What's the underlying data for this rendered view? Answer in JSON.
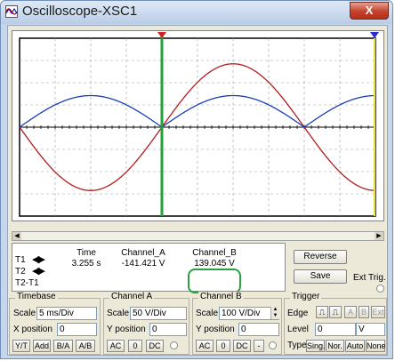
{
  "window": {
    "title": "Oscilloscope-XSC1",
    "close_label": "X",
    "accent": "#c3422c"
  },
  "readout": {
    "row_labels": [
      "T1",
      "T2",
      "T2-T1"
    ],
    "headers": {
      "time": "Time",
      "channel_a": "Channel_A",
      "channel_b": "Channel_B"
    },
    "t1": {
      "time": "3.255 s",
      "channel_a": "-141.421 V",
      "channel_b": "139.045 V"
    },
    "highlight_color": "#2aa043"
  },
  "buttons": {
    "reverse": "Reverse",
    "save": "Save",
    "ext_trig": "Ext Trig."
  },
  "timebase": {
    "title": "Timebase",
    "scale_label": "Scale",
    "scale_value": "5 ms/Div",
    "xpos_label": "X position",
    "xpos_value": "0",
    "modes": [
      "Y/T",
      "Add",
      "B/A",
      "A/B"
    ]
  },
  "channel_a": {
    "title": "Channel A",
    "scale_label": "Scale",
    "scale_value": "50  V/Div",
    "ypos_label": "Y position",
    "ypos_value": "0",
    "coupling": [
      "AC",
      "0",
      "DC"
    ]
  },
  "channel_b": {
    "title": "Channel B",
    "scale_label": "Scale",
    "scale_value": "100  V/Div",
    "ypos_label": "Y position",
    "ypos_value": "0",
    "coupling": [
      "AC",
      "0",
      "DC",
      "-"
    ]
  },
  "trigger": {
    "title": "Trigger",
    "edge_label": "Edge",
    "sources": [
      "A",
      "B",
      "Ext"
    ],
    "level_label": "Level",
    "level_value": "0",
    "level_unit": "V",
    "type_label": "Type",
    "types": [
      "Sing.",
      "Nor.",
      "Auto",
      "None"
    ]
  },
  "screen": {
    "colors": {
      "channel_a": "#b01c1c",
      "channel_b": "#1a3fb0",
      "cursor_t1": "#23a13a",
      "cursor_t1_marker": "#d02020",
      "cursor_t2_marker": "#2a2ad0",
      "grid": "#9e9e9e"
    }
  },
  "chart_data": {
    "type": "line",
    "x": [
      0,
      0.5,
      1,
      1.5,
      2,
      2.5,
      3,
      3.5,
      4,
      4.5,
      5,
      5.5,
      6,
      6.5,
      7,
      7.5,
      8,
      8.5,
      9,
      9.5,
      10
    ],
    "series": [
      {
        "name": "Channel_A",
        "values": [
          0,
          -2.0,
          -2.85,
          -2.0,
          0,
          2.0,
          2.85,
          2.0,
          0,
          -2.0,
          -2.85,
          -2.0,
          0,
          2.0,
          2.85,
          2.0,
          0,
          -2.0,
          -2.85,
          -2.0,
          0
        ]
      },
      {
        "name": "Channel_B",
        "values": [
          0,
          1.0,
          1.42,
          1.0,
          0,
          1.0,
          1.42,
          1.0,
          0,
          1.0,
          1.42,
          1.0,
          0,
          1.0,
          1.42,
          1.0,
          0,
          1.0,
          1.42,
          1.0,
          0
        ]
      }
    ],
    "xlabel": "",
    "ylabel": "",
    "xlim": [
      0,
      10
    ],
    "ylim": [
      -4,
      4
    ],
    "grid": true,
    "cursor_t1_x": 4.0
  }
}
